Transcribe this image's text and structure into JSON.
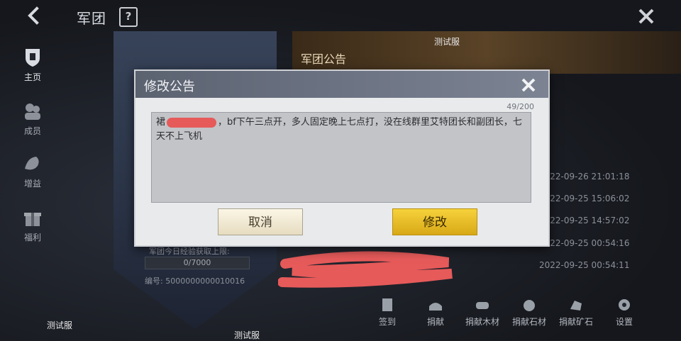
{
  "header": {
    "title": "军团"
  },
  "sidebar": {
    "items": [
      {
        "label": "主页"
      },
      {
        "label": "成员"
      },
      {
        "label": "增益"
      },
      {
        "label": "福利"
      }
    ]
  },
  "notice_panel": {
    "title": "军团公告",
    "server_tag": "测试服"
  },
  "logs": [
    "2022-09-26 21:01:18",
    "2022-09-25 15:06:02",
    "2022-09-25 14:57:02",
    "2022-09-25 00:54:16",
    "2022-09-25 00:54:11"
  ],
  "guild_info": {
    "exp_label": "军团今日经验获取上限:",
    "exp_value": "0/7000",
    "id_label": "编号: 5000000000010016"
  },
  "actions": [
    {
      "label": "签到"
    },
    {
      "label": "捐献"
    },
    {
      "label": "捐献木材"
    },
    {
      "label": "捐献石材"
    },
    {
      "label": "捐献矿石"
    },
    {
      "label": "设置"
    }
  ],
  "modal": {
    "title": "修改公告",
    "counter": "49/200",
    "text_before": "裙",
    "text_after": "，bf下午三点开，多人固定晚上七点打，没在线群里艾特团长和副团长，七天不上飞机",
    "cancel_label": "取消",
    "confirm_label": "修改"
  },
  "watermarks": [
    "测试服",
    "测试服"
  ],
  "colors": {
    "confirm": "#f0c52e",
    "cancel": "#f3ecd6",
    "redact": "#e65a5a"
  }
}
